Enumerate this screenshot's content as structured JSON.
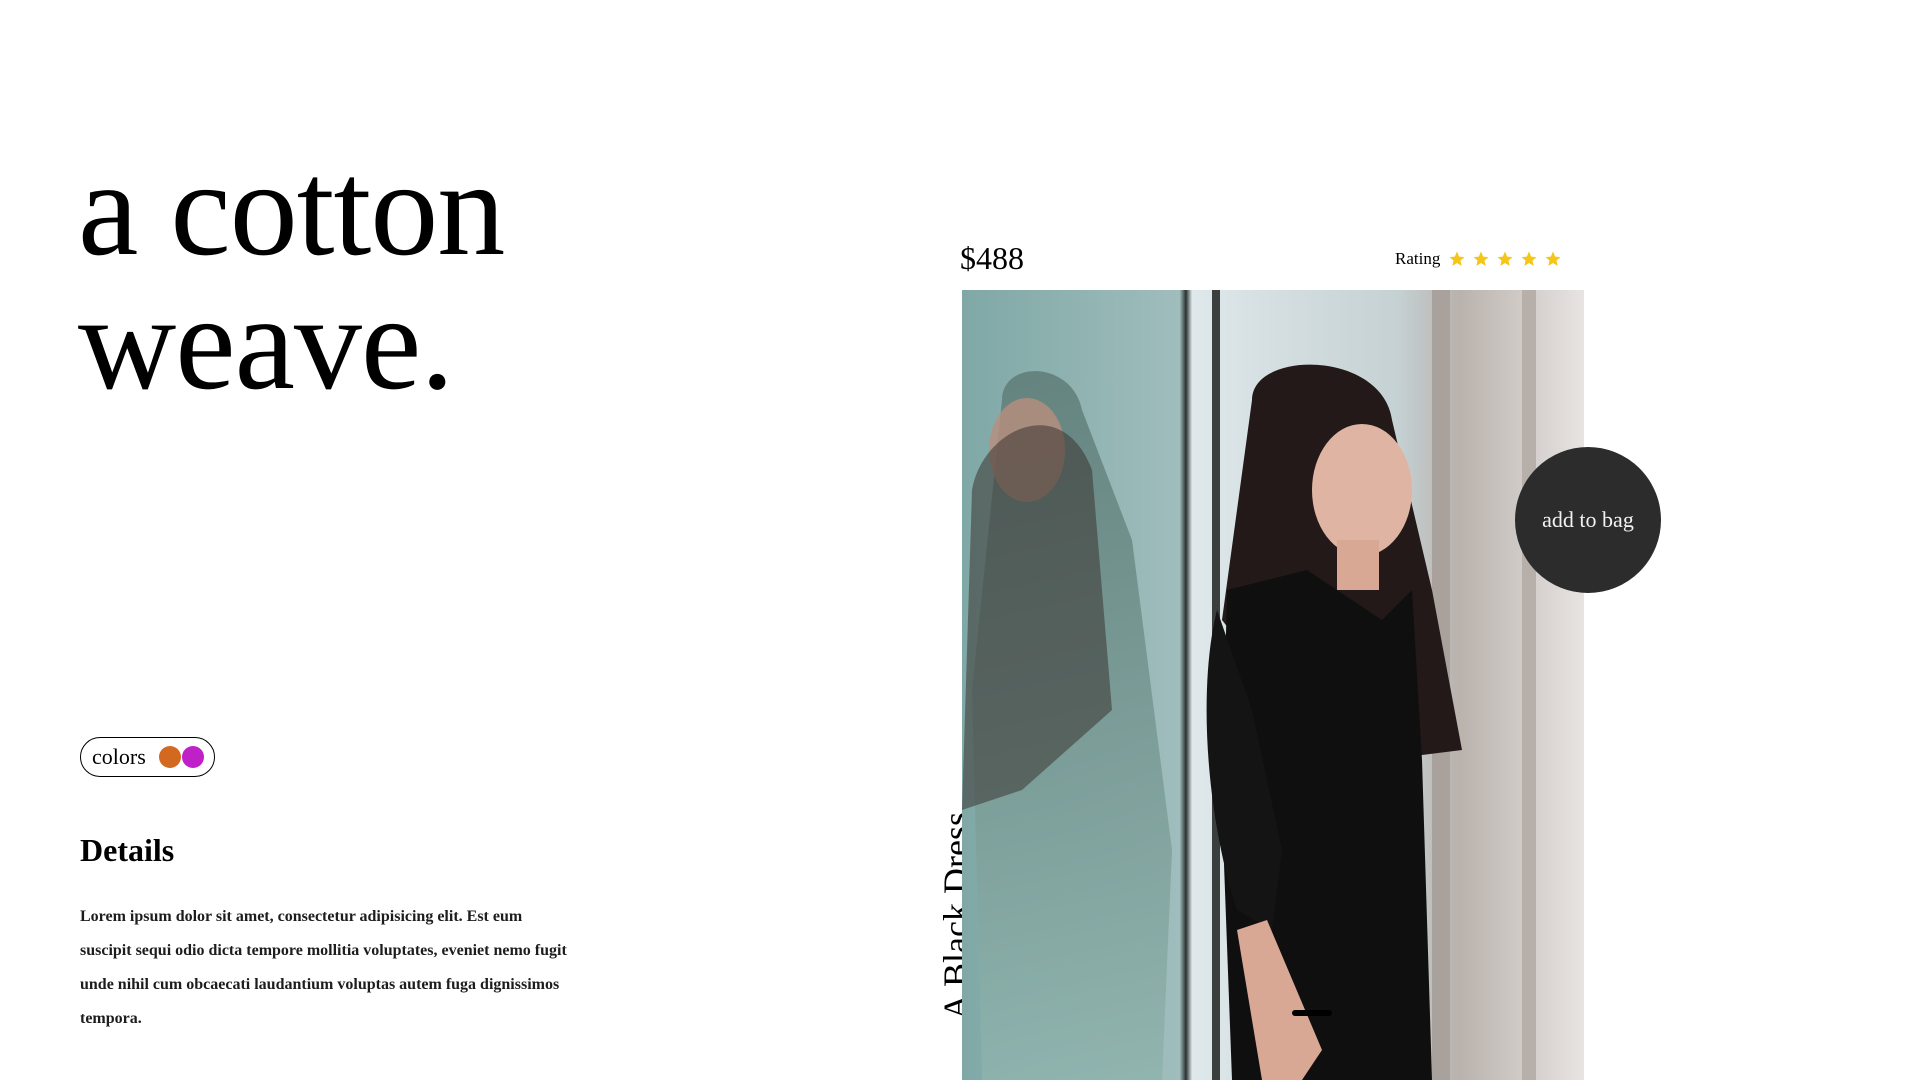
{
  "headline": {
    "line1": "a cotton",
    "line2": "weave."
  },
  "colors": {
    "label": "colors",
    "swatches": [
      "#d2691e",
      "#c020c8"
    ]
  },
  "details": {
    "title": "Details",
    "text": "Lorem ipsum dolor sit amet, consectetur adipisicing elit. Est eum suscipit sequi odio dicta tempore mollitia voluptates, eveniet nemo fugit unde nihil cum obcaecati laudantium voluptas autem fuga dignissimos tempora."
  },
  "product": {
    "name": "A Black Dress",
    "price": "$488",
    "rating_label": "Rating",
    "rating_stars": 5,
    "star_color": "#f5c518",
    "add_to_bag_label": "add to bag"
  }
}
